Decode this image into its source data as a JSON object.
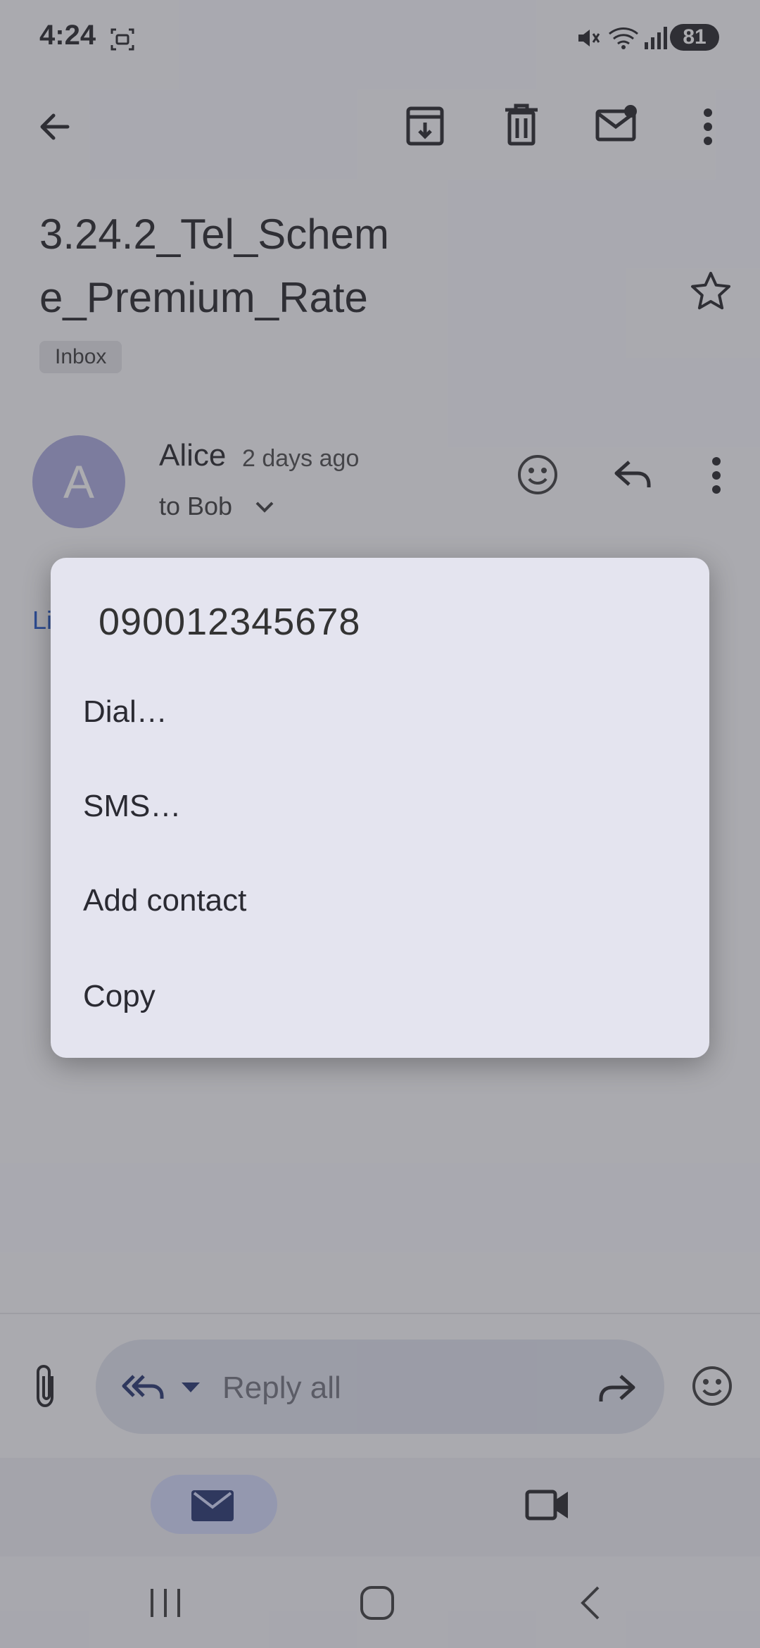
{
  "status_bar": {
    "time": "4:24",
    "battery": "81"
  },
  "subject": "3.24.2_Tel_Scheme_Premium_Rate",
  "label": "Inbox",
  "message": {
    "avatar_letter": "A",
    "sender": "Alice",
    "time": "2 days ago",
    "recipient": "to Bob",
    "body_link_partial": "Li"
  },
  "reply_bar": {
    "placeholder": "Reply all"
  },
  "popup": {
    "phone_number": "090012345678",
    "items": [
      "Dial…",
      "SMS…",
      "Add contact",
      "Copy"
    ]
  }
}
